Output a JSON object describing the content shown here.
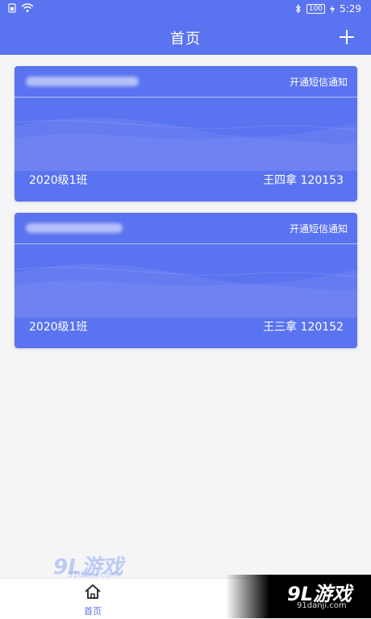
{
  "status_bar": {
    "left_icons": [
      "sim-icon",
      "wifi-icon"
    ],
    "bluetooth_icon": "bluetooth-icon",
    "battery": "100",
    "charging_icon": "bolt-icon",
    "time": "5:29"
  },
  "header": {
    "title": "首页",
    "add_icon": "plus-icon"
  },
  "cards": [
    {
      "school_name_blurred": true,
      "sms_action": "开通短信通知",
      "class_name": "2020级1班",
      "student": "王四拿 120153"
    },
    {
      "school_name_blurred": true,
      "sms_action": "开通短信通知",
      "class_name": "2020级1班",
      "student": "王三拿 120152"
    }
  ],
  "tabbar": {
    "home_label": "首页",
    "home_icon": "home-icon"
  },
  "watermarks": {
    "left_main": "9L游戏",
    "left_sub": "91danji.com",
    "right_main": "9L游戏",
    "right_sub": "91danji.com"
  },
  "colors": {
    "primary": "#5a73f0",
    "background": "#f5f5f7"
  }
}
